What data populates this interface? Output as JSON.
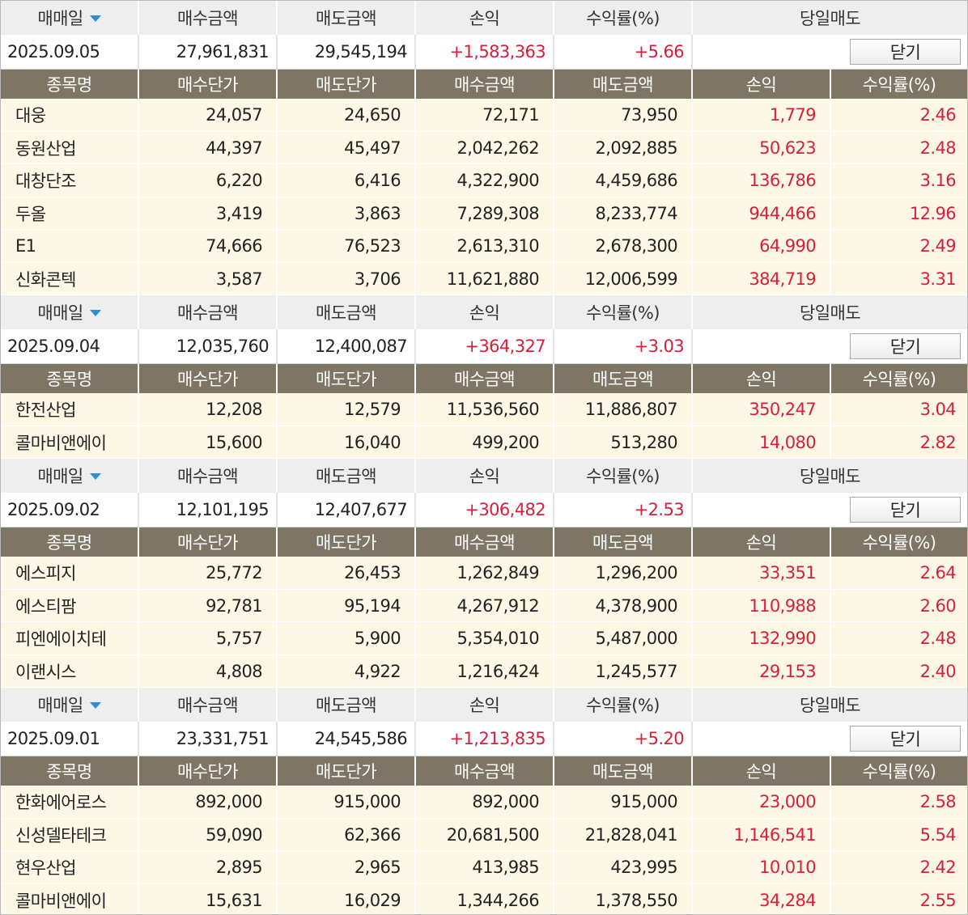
{
  "summary_headers": {
    "date": "매매일",
    "buy_amount": "매수금액",
    "sell_amount": "매도금액",
    "pnl": "손익",
    "return_rate": "수익률(%)",
    "same_day_sell": "당일매도"
  },
  "detail_headers": {
    "name": "종목명",
    "buy_price": "매수단가",
    "sell_price": "매도단가",
    "buy_amount": "매수금액",
    "sell_amount": "매도금액",
    "pnl": "손익",
    "return_rate": "수익률(%)"
  },
  "close_label": "닫기",
  "colors": {
    "header_brown": "#7e7565",
    "row_cream": "#fdf8e6",
    "profit_red": "#d81e3a",
    "summary_gray": "#eeeeee",
    "sort_arrow": "#2a8fd6"
  },
  "groups": [
    {
      "date": "2025.09.05",
      "buy_amount": "27,961,831",
      "sell_amount": "29,545,194",
      "pnl": "+1,583,363",
      "return_rate": "+5.66",
      "items": [
        {
          "name": "대웅",
          "buy_price": "24,057",
          "sell_price": "24,650",
          "buy_amount": "72,171",
          "sell_amount": "73,950",
          "pnl": "1,779",
          "return_rate": "2.46"
        },
        {
          "name": "동원산업",
          "buy_price": "44,397",
          "sell_price": "45,497",
          "buy_amount": "2,042,262",
          "sell_amount": "2,092,885",
          "pnl": "50,623",
          "return_rate": "2.48"
        },
        {
          "name": "대창단조",
          "buy_price": "6,220",
          "sell_price": "6,416",
          "buy_amount": "4,322,900",
          "sell_amount": "4,459,686",
          "pnl": "136,786",
          "return_rate": "3.16"
        },
        {
          "name": "두올",
          "buy_price": "3,419",
          "sell_price": "3,863",
          "buy_amount": "7,289,308",
          "sell_amount": "8,233,774",
          "pnl": "944,466",
          "return_rate": "12.96"
        },
        {
          "name": "E1",
          "buy_price": "74,666",
          "sell_price": "76,523",
          "buy_amount": "2,613,310",
          "sell_amount": "2,678,300",
          "pnl": "64,990",
          "return_rate": "2.49"
        },
        {
          "name": "신화콘텍",
          "buy_price": "3,587",
          "sell_price": "3,706",
          "buy_amount": "11,621,880",
          "sell_amount": "12,006,599",
          "pnl": "384,719",
          "return_rate": "3.31"
        }
      ]
    },
    {
      "date": "2025.09.04",
      "buy_amount": "12,035,760",
      "sell_amount": "12,400,087",
      "pnl": "+364,327",
      "return_rate": "+3.03",
      "items": [
        {
          "name": "한전산업",
          "buy_price": "12,208",
          "sell_price": "12,579",
          "buy_amount": "11,536,560",
          "sell_amount": "11,886,807",
          "pnl": "350,247",
          "return_rate": "3.04"
        },
        {
          "name": "콜마비앤에이",
          "buy_price": "15,600",
          "sell_price": "16,040",
          "buy_amount": "499,200",
          "sell_amount": "513,280",
          "pnl": "14,080",
          "return_rate": "2.82"
        }
      ]
    },
    {
      "date": "2025.09.02",
      "buy_amount": "12,101,195",
      "sell_amount": "12,407,677",
      "pnl": "+306,482",
      "return_rate": "+2.53",
      "items": [
        {
          "name": "에스피지",
          "buy_price": "25,772",
          "sell_price": "26,453",
          "buy_amount": "1,262,849",
          "sell_amount": "1,296,200",
          "pnl": "33,351",
          "return_rate": "2.64"
        },
        {
          "name": "에스티팜",
          "buy_price": "92,781",
          "sell_price": "95,194",
          "buy_amount": "4,267,912",
          "sell_amount": "4,378,900",
          "pnl": "110,988",
          "return_rate": "2.60"
        },
        {
          "name": "피엔에이치테",
          "buy_price": "5,757",
          "sell_price": "5,900",
          "buy_amount": "5,354,010",
          "sell_amount": "5,487,000",
          "pnl": "132,990",
          "return_rate": "2.48"
        },
        {
          "name": "이랜시스",
          "buy_price": "4,808",
          "sell_price": "4,922",
          "buy_amount": "1,216,424",
          "sell_amount": "1,245,577",
          "pnl": "29,153",
          "return_rate": "2.40"
        }
      ]
    },
    {
      "date": "2025.09.01",
      "buy_amount": "23,331,751",
      "sell_amount": "24,545,586",
      "pnl": "+1,213,835",
      "return_rate": "+5.20",
      "items": [
        {
          "name": "한화에어로스",
          "buy_price": "892,000",
          "sell_price": "915,000",
          "buy_amount": "892,000",
          "sell_amount": "915,000",
          "pnl": "23,000",
          "return_rate": "2.58"
        },
        {
          "name": "신성델타테크",
          "buy_price": "59,090",
          "sell_price": "62,366",
          "buy_amount": "20,681,500",
          "sell_amount": "21,828,041",
          "pnl": "1,146,541",
          "return_rate": "5.54"
        },
        {
          "name": "현우산업",
          "buy_price": "2,895",
          "sell_price": "2,965",
          "buy_amount": "413,985",
          "sell_amount": "423,995",
          "pnl": "10,010",
          "return_rate": "2.42"
        },
        {
          "name": "콜마비앤에이",
          "buy_price": "15,631",
          "sell_price": "16,029",
          "buy_amount": "1,344,266",
          "sell_amount": "1,378,550",
          "pnl": "34,284",
          "return_rate": "2.55"
        }
      ]
    }
  ]
}
